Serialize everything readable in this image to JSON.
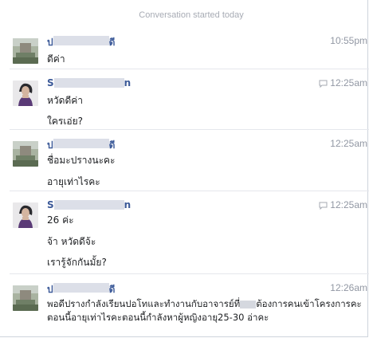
{
  "conversation_notice": "Conversation started today",
  "messages": [
    {
      "sender_prefix": "ป",
      "sender_suffix": "ดี",
      "time": "10:55pm",
      "has_reply_icon": false,
      "avatar": "profile-photo-1",
      "lines": [
        "ดีค่า"
      ]
    },
    {
      "sender_prefix": "S",
      "sender_suffix": "n",
      "time": "12:25am",
      "has_reply_icon": true,
      "avatar": "profile-photo-2",
      "lines": [
        "หวัดดีค่า",
        "ใครเอ่ย?"
      ]
    },
    {
      "sender_prefix": "ป",
      "sender_suffix": "ดี",
      "time": "12:25am",
      "has_reply_icon": false,
      "avatar": "profile-photo-1",
      "lines": [
        "ชื่อมะปรางนะคะ",
        "อายุเท่าไรคะ"
      ]
    },
    {
      "sender_prefix": "S",
      "sender_suffix": "n",
      "time": "12:25am",
      "has_reply_icon": true,
      "avatar": "profile-photo-2",
      "lines": [
        "26 ค่ะ",
        "จ้า หวัดดีจ้ะ",
        "เรารู้จักกันมั้ย?"
      ]
    },
    {
      "sender_prefix": "ป",
      "sender_suffix": "ดี",
      "time": "12:26am",
      "has_reply_icon": false,
      "avatar": "profile-photo-1",
      "long_text_before": "พอดีปรางกำลังเรียนปอโทและทำงานกับอาจารย์ที่",
      "long_text_after": "ต้องการคนเข้าโครงการคะตอนนี้อายุเท่าไรคะตอนนี้กำลังหาผู้หญิงอายุ25-30 อ่าคะ"
    }
  ]
}
